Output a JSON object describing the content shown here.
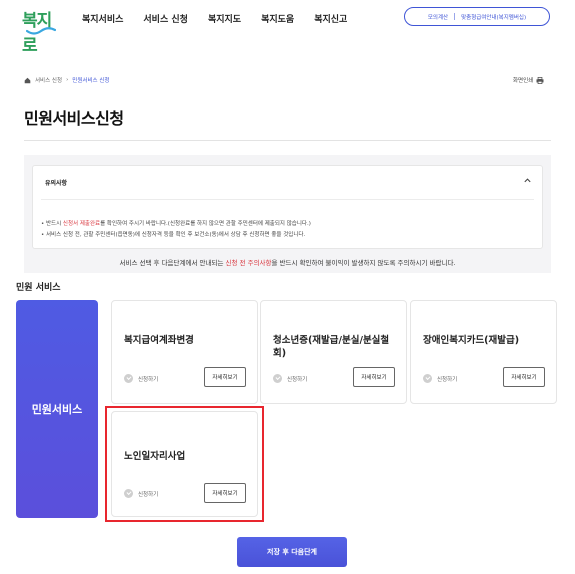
{
  "header": {
    "logo_text": "복지로",
    "nav": [
      "복지서비스",
      "서비스 신청",
      "복지지도",
      "복지도움",
      "복지신고"
    ],
    "util_links": [
      "모의계산",
      "맞춤형급여안내(복지멤버십)"
    ]
  },
  "breadcrumb": {
    "items": [
      "서비스 신청",
      "민원서비스 신청"
    ]
  },
  "print_label": "화면인쇄",
  "page_title": "민원서비스신청",
  "notice": {
    "title": "유의사항",
    "line1_prefix": "• 반드시 ",
    "line1_red": "신청서 제출완료",
    "line1_suffix": "를 확인하여 주시기 바랍니다.(신청완료를 하지 않으면 관할 주민센터에 제출되지 않습니다.)",
    "line2": "• 서비스 신청 전, 관할 주민센터(읍면동)에 신청자격 등을 확인 후 보건소(동)에서 상담 후 신청하면 좋을 것입니다.",
    "bottom_prefix": "서비스 선택 후 다음단계에서 안내되는 ",
    "bottom_red": "신청 전 주의사항",
    "bottom_suffix": "을 반드시 확인하여 불이익이 발생하지 않도록 주의하시기 바랍니다."
  },
  "section_label": "민원 서비스",
  "side_tab_label": "민원서비스",
  "cards": [
    {
      "title": "복지급여계좌변경",
      "apply": "신청하기",
      "detail": "자세히보기"
    },
    {
      "title": "청소년증(재발급/분실/분실철회)",
      "apply": "신청하기",
      "detail": "자세히보기"
    },
    {
      "title": "장애인복지카드(재발급)",
      "apply": "신청하기",
      "detail": "자세히보기"
    },
    {
      "title": "노인일자리사업",
      "apply": "신청하기",
      "detail": "자세히보기"
    }
  ],
  "submit_label": "저장 후 다음단계",
  "colors": {
    "accent": "#3f55d6",
    "brand_green": "#2e9f5b",
    "alert_red": "#d9363e",
    "highlight": "#e8262e"
  }
}
